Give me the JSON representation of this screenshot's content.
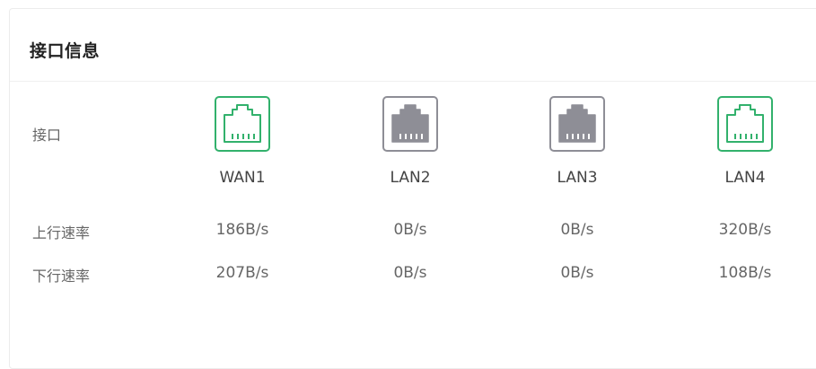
{
  "panel": {
    "title": "接口信息"
  },
  "labels": {
    "interface": "接口",
    "upload_rate": "上行速率",
    "download_rate": "下行速率"
  },
  "colors": {
    "connected": "#32b16c",
    "disconnected": "#8e8e96"
  },
  "ports": [
    {
      "name": "WAN1",
      "status": "connected",
      "icon": "ethernet-port-icon",
      "upload": "186B/s",
      "download": "207B/s"
    },
    {
      "name": "LAN2",
      "status": "disconnected",
      "icon": "ethernet-port-icon",
      "upload": "0B/s",
      "download": "0B/s"
    },
    {
      "name": "LAN3",
      "status": "disconnected",
      "icon": "ethernet-port-icon",
      "upload": "0B/s",
      "download": "0B/s"
    },
    {
      "name": "LAN4",
      "status": "connected",
      "icon": "ethernet-port-icon",
      "upload": "320B/s",
      "download": "108B/s"
    }
  ]
}
